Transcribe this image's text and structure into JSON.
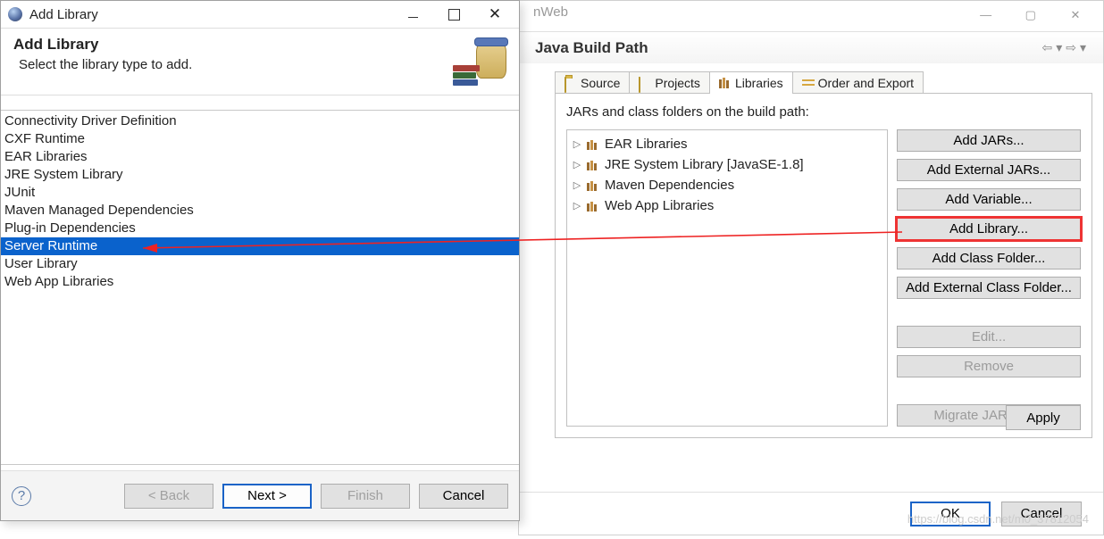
{
  "properties": {
    "title_fragment": "nWeb",
    "heading": "Java Build Path",
    "tabs": {
      "source": "Source",
      "projects": "Projects",
      "libraries": "Libraries",
      "order": "Order and Export"
    },
    "caption": "JARs and class folders on the build path:",
    "tree": [
      "EAR Libraries",
      "JRE System Library [JavaSE-1.8]",
      "Maven Dependencies",
      "Web App Libraries"
    ],
    "buttons": {
      "add_jars": "Add JARs...",
      "add_ext_jars": "Add External JARs...",
      "add_variable": "Add Variable...",
      "add_library": "Add Library...",
      "add_class_folder": "Add Class Folder...",
      "add_ext_class_folder": "Add External Class Folder...",
      "edit": "Edit...",
      "remove": "Remove",
      "migrate": "Migrate JAR File..."
    },
    "apply": "Apply",
    "ok": "OK",
    "cancel": "Cancel"
  },
  "wizard": {
    "title": "Add Library",
    "banner_heading": "Add Library",
    "banner_sub": "Select the library type to add.",
    "items": [
      "Connectivity Driver Definition",
      "CXF Runtime",
      "EAR Libraries",
      "JRE System Library",
      "JUnit",
      "Maven Managed Dependencies",
      "Plug-in Dependencies",
      "Server Runtime",
      "User Library",
      "Web App Libraries"
    ],
    "selected_index": 7,
    "back": "< Back",
    "next": "Next >",
    "finish": "Finish",
    "cancel": "Cancel",
    "help": "?"
  },
  "watermark": "https://blog.csdn.net/m0_37812054"
}
